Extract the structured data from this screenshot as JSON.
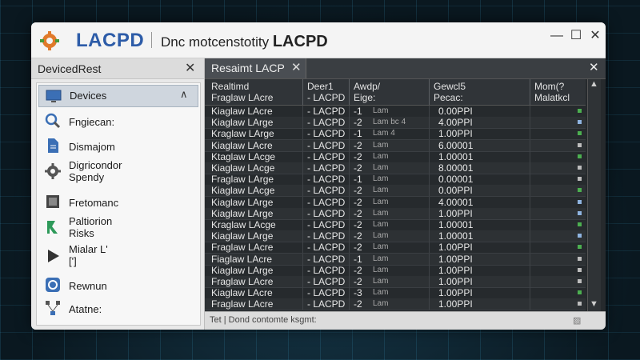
{
  "app": {
    "name": "LACPD",
    "title_prefix": "Dnc motcenstotity",
    "title_bold": "LACPD"
  },
  "window_controls": {
    "minimize": "—",
    "maximize": "☐",
    "close": "✕"
  },
  "left_panel": {
    "tab_label": "DevicedRest",
    "close": "✕",
    "items": [
      {
        "label": "Devices",
        "icon": "monitor-icon",
        "selected": true,
        "chevron": "∧"
      },
      {
        "label": "Fngiecan:",
        "icon": "search-icon"
      },
      {
        "label": "Dismajom",
        "icon": "document-icon"
      },
      {
        "label": "Digricondor\nSpendy",
        "icon": "gear-icon"
      },
      {
        "label": "Fretomanc",
        "icon": "frame-icon"
      },
      {
        "label": "Paltiorion\nRisks",
        "icon": "network-icon"
      },
      {
        "label": "Mialar L'\n[']",
        "icon": "play-icon"
      },
      {
        "label": "Rewnun",
        "icon": "settings-badge-icon"
      },
      {
        "label": "Atatne:",
        "icon": "topology-icon"
      }
    ]
  },
  "right_panel": {
    "tab_label": "Resaimt LACP",
    "tab_close": "✕",
    "panel_close": "✕",
    "headers": [
      {
        "line1": "Realtimd",
        "line2": "Fraglaw LAcre"
      },
      {
        "line1": "Deer1",
        "line2": "- LACPD"
      },
      {
        "line1": "Awdp/",
        "line2": "Eige:"
      },
      {
        "line1": "Gewcl5",
        "line2": "Pecac:"
      },
      {
        "line1": "Mom(?",
        "line2": "Malatkcl"
      }
    ],
    "rows": [
      {
        "c1": "Kiaglaw LAcre",
        "c2": "- LACPD",
        "c3": "-1",
        "c4": "Lam",
        "c5": "0.00PPI",
        "status": "#4caf50"
      },
      {
        "c1": "Kiaglaw LArge",
        "c2": "- LACPD",
        "c3": "-2",
        "c4": "Lam bc 4",
        "c5": "4.00PPI",
        "status": "#8fb4e0"
      },
      {
        "c1": "Kraglaw LArge",
        "c2": "- LACPD",
        "c3": "-1",
        "c4": "Lam 4",
        "c5": "1.00PPI",
        "status": "#4caf50"
      },
      {
        "c1": "Kiaglaw LAcre",
        "c2": "- LACPD",
        "c3": "-2",
        "c4": "Lam",
        "c5": "6.00001",
        "status": "#bdbdbd"
      },
      {
        "c1": "Ktaglaw LAcge",
        "c2": "- LACPD",
        "c3": "-2",
        "c4": "Lam",
        "c5": "1.00001",
        "status": "#4caf50"
      },
      {
        "c1": "Kiaglaw LAcge",
        "c2": "- LACPD",
        "c3": "-2",
        "c4": "Lam",
        "c5": "8.00001",
        "status": "#bdbdbd"
      },
      {
        "c1": "Fraglaw LArge",
        "c2": "- LACPD",
        "c3": "-1",
        "c4": "Lam",
        "c5": "0.00001",
        "status": "#bdbdbd"
      },
      {
        "c1": "Kiaglaw LAcge",
        "c2": "- LACPD",
        "c3": "-2",
        "c4": "Lam",
        "c5": "0.00PPI",
        "status": "#4caf50"
      },
      {
        "c1": "Kiaglaw LArge",
        "c2": "- LACPD",
        "c3": "-2",
        "c4": "Lam",
        "c5": "4.00001",
        "status": "#8fb4e0"
      },
      {
        "c1": "Kiaglaw LArge",
        "c2": "- LACPD",
        "c3": "-2",
        "c4": "Lam",
        "c5": "1.00PPI",
        "status": "#8fb4e0"
      },
      {
        "c1": "Kraglaw LAcge",
        "c2": "- LACPD",
        "c3": "-2",
        "c4": "Lam",
        "c5": "1.00001",
        "status": "#4caf50"
      },
      {
        "c1": "Kiaglaw LArge",
        "c2": "- LACPD",
        "c3": "-2",
        "c4": "Lam",
        "c5": "1.00001",
        "status": "#8fb4e0"
      },
      {
        "c1": "Fraglaw LAcre",
        "c2": "- LACPD",
        "c3": "-2",
        "c4": "Lam",
        "c5": "1.00PPI",
        "status": "#4caf50"
      },
      {
        "c1": "Fiaglaw LAcre",
        "c2": "- LACPD",
        "c3": "-1",
        "c4": "Lam",
        "c5": "1.00PPI",
        "status": "#bdbdbd"
      },
      {
        "c1": "Kiaglaw LArge",
        "c2": "- LACPD",
        "c3": "-2",
        "c4": "Lam",
        "c5": "1.00PPI",
        "status": "#bdbdbd"
      },
      {
        "c1": "Fraglaw LAcre",
        "c2": "- LACPD",
        "c3": "-2",
        "c4": "Lam",
        "c5": "1.00PPI",
        "status": "#bdbdbd"
      },
      {
        "c1": "Kiaglaw LAcre",
        "c2": "- LACPD",
        "c3": "-3",
        "c4": "Lam",
        "c5": "1.00PPI",
        "status": "#4caf50"
      },
      {
        "c1": "Fraglaw LAcre",
        "c2": "- LACPD",
        "c3": "-2",
        "c4": "Lam",
        "c5": "1.00PPI",
        "status": "#bdbdbd"
      }
    ],
    "status_bar": "Tet | Dond contomte ksgmt:"
  },
  "colors": {
    "brand": "#2d5ca8",
    "status_green": "#4caf50",
    "status_blue": "#8fb4e0",
    "status_gray": "#bdbdbd"
  }
}
